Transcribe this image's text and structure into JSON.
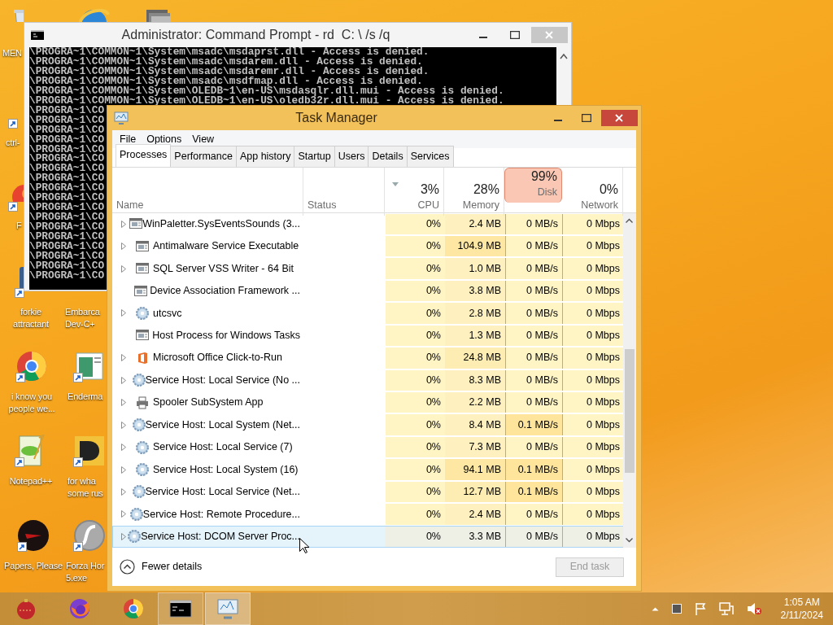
{
  "desktop": {
    "icons": [
      {
        "kind": "bin",
        "label_lines": [
          "MEN"
        ]
      },
      {
        "kind": "ie"
      },
      {
        "kind": "stack"
      },
      {
        "shortcut": true,
        "label_lines": [
          "ctrl-"
        ]
      },
      {
        "kind": "red-app",
        "shortcut": true,
        "label_lines": [
          "F"
        ]
      },
      {
        "kind": "app",
        "shortcut": true,
        "label_lines": [
          "forkie",
          "attractant"
        ]
      },
      {
        "label_lines": [
          "Embarca",
          "Dev-C+"
        ]
      },
      {
        "kind": "chrome",
        "shortcut": true,
        "label_lines": [
          "i know you",
          "people we..."
        ]
      },
      {
        "kind": "window-app",
        "shortcut": true,
        "label_lines": [
          "Enderma"
        ]
      },
      {
        "kind": "notepad",
        "shortcut": true,
        "label_lines": [
          "Notepad++"
        ]
      },
      {
        "kind": "yellow-app",
        "shortcut": true,
        "label_lines": [
          "for wha",
          "some rus"
        ]
      },
      {
        "kind": "dark-disc",
        "shortcut": true,
        "label_lines": [
          "Papers, Please"
        ]
      },
      {
        "kind": "flash",
        "shortcut": true,
        "label_lines": [
          "Forza Hor",
          "5.exe"
        ]
      }
    ]
  },
  "command_prompt": {
    "title": "Administrator: Command Prompt - rd  C: \\ /s /q",
    "lines": [
      "\\PROGRA~1\\COMMON~1\\System\\msadc\\msdaprst.dll - Access is denied.",
      "\\PROGRA~1\\COMMON~1\\System\\msadc\\msdarem.dll - Access is denied.",
      "\\PROGRA~1\\COMMON~1\\System\\msadc\\msdaremr.dll - Access is denied.",
      "\\PROGRA~1\\COMMON~1\\System\\msadc\\msdfmap.dll - Access is denied.",
      "\\PROGRA~1\\COMMON~1\\System\\OLEDB~1\\en-US\\msdasqlr.dll.mui - Access is denied.",
      "\\PROGRA~1\\COMMON~1\\System\\OLEDB~1\\en-US\\oledb32r.dll.mui - Access is denied.",
      "\\PROGRA~1\\CO",
      "\\PROGRA~1\\CO",
      "\\PROGRA~1\\CO",
      "\\PROGRA~1\\CO",
      "\\PROGRA~1\\CO",
      "\\PROGRA~1\\CO",
      "\\PROGRA~1\\CO",
      "\\PROGRA~1\\CO",
      "\\PROGRA~1\\CO",
      "\\PROGRA~1\\CO",
      "\\PROGRA~1\\CO",
      "\\PROGRA~1\\CO",
      "\\PROGRA~1\\CO",
      "\\PROGRA~1\\CO",
      "\\PROGRA~1\\CO",
      "\\PROGRA~1\\CO",
      "\\PROGRA~1\\CO",
      "\\PROGRA~1\\CO"
    ]
  },
  "task_manager": {
    "title": "Task Manager",
    "menu": [
      "File",
      "Options",
      "View"
    ],
    "tabs": [
      {
        "label": "Processes",
        "selected": true
      },
      {
        "label": "Performance",
        "selected": false
      },
      {
        "label": "App history",
        "selected": false
      },
      {
        "label": "Startup",
        "selected": false
      },
      {
        "label": "Users",
        "selected": false
      },
      {
        "label": "Details",
        "selected": false
      },
      {
        "label": "Services",
        "selected": false
      }
    ],
    "columns": [
      {
        "label": "Name",
        "alert": false
      },
      {
        "label": "Status",
        "alert": false
      },
      {
        "usage": "3%",
        "label": "CPU",
        "alert": false,
        "sorted": true
      },
      {
        "usage": "28%",
        "label": "Memory",
        "alert": false
      },
      {
        "usage": "99%",
        "label": "Disk",
        "alert": true
      },
      {
        "usage": "0%",
        "label": "Network",
        "alert": false
      }
    ],
    "rows": [
      {
        "name": "WinPaletter.SysEventsSounds (3...",
        "kind": "window",
        "expandable": true,
        "selected": false,
        "cpu": "0%",
        "memory": "2.4 MB",
        "disk": "0 MB/s",
        "network": "0 Mbps"
      },
      {
        "name": "Antimalware Service Executable",
        "kind": "window",
        "expandable": true,
        "selected": false,
        "cpu": "0%",
        "memory": "104.9 MB",
        "disk": "0 MB/s",
        "network": "0 Mbps"
      },
      {
        "name": "SQL Server VSS Writer - 64 Bit",
        "kind": "window",
        "expandable": true,
        "selected": false,
        "cpu": "0%",
        "memory": "1.0 MB",
        "disk": "0 MB/s",
        "network": "0 Mbps"
      },
      {
        "name": "Device Association Framework ...",
        "kind": "window",
        "expandable": false,
        "selected": false,
        "cpu": "0%",
        "memory": "3.8 MB",
        "disk": "0 MB/s",
        "network": "0 Mbps"
      },
      {
        "name": "utcsvc",
        "kind": "gear",
        "expandable": true,
        "selected": false,
        "cpu": "0%",
        "memory": "2.8 MB",
        "disk": "0 MB/s",
        "network": "0 Mbps"
      },
      {
        "name": "Host Process for Windows Tasks",
        "kind": "window",
        "expandable": false,
        "selected": false,
        "cpu": "0%",
        "memory": "1.3 MB",
        "disk": "0 MB/s",
        "network": "0 Mbps"
      },
      {
        "name": "Microsoft Office Click-to-Run",
        "kind": "office",
        "expandable": true,
        "selected": false,
        "cpu": "0%",
        "memory": "24.8 MB",
        "disk": "0 MB/s",
        "network": "0 Mbps"
      },
      {
        "name": "Service Host: Local Service (No ...",
        "kind": "gear",
        "expandable": true,
        "selected": false,
        "cpu": "0%",
        "memory": "8.3 MB",
        "disk": "0 MB/s",
        "network": "0 Mbps"
      },
      {
        "name": "Spooler SubSystem App",
        "kind": "printer",
        "expandable": true,
        "selected": false,
        "cpu": "0%",
        "memory": "2.2 MB",
        "disk": "0 MB/s",
        "network": "0 Mbps"
      },
      {
        "name": "Service Host: Local System (Net...",
        "kind": "gear",
        "expandable": true,
        "selected": false,
        "cpu": "0%",
        "memory": "8.4 MB",
        "disk": "0.1 MB/s",
        "network": "0 Mbps"
      },
      {
        "name": "Service Host: Local Service (7)",
        "kind": "gear",
        "expandable": true,
        "selected": false,
        "cpu": "0%",
        "memory": "7.3 MB",
        "disk": "0 MB/s",
        "network": "0 Mbps"
      },
      {
        "name": "Service Host: Local System (16)",
        "kind": "gear",
        "expandable": true,
        "selected": false,
        "cpu": "0%",
        "memory": "94.1 MB",
        "disk": "0.1 MB/s",
        "network": "0 Mbps"
      },
      {
        "name": "Service Host: Local Service (Net...",
        "kind": "gear",
        "expandable": true,
        "selected": false,
        "cpu": "0%",
        "memory": "12.7 MB",
        "disk": "0.1 MB/s",
        "network": "0 Mbps"
      },
      {
        "name": "Service Host: Remote Procedure...",
        "kind": "gear",
        "expandable": true,
        "selected": false,
        "cpu": "0%",
        "memory": "2.4 MB",
        "disk": "0 MB/s",
        "network": "0 Mbps"
      },
      {
        "name": "Service Host: DCOM Server Proc...",
        "kind": "gear",
        "expandable": true,
        "selected": true,
        "cpu": "0%",
        "memory": "3.3 MB",
        "disk": "0 MB/s",
        "network": "0 Mbps"
      }
    ],
    "footer": {
      "toggle": "Fewer details",
      "end_task": {
        "label": "End task",
        "disabled": true
      }
    }
  },
  "taskbar": {
    "apps": [
      {
        "kind": "ornament",
        "open": false,
        "selected": false
      },
      {
        "kind": "firefox",
        "open": false,
        "selected": false
      },
      {
        "kind": "chrome",
        "open": false,
        "selected": false
      },
      {
        "kind": "console",
        "open": true,
        "selected": false
      },
      {
        "kind": "monitor",
        "open": true,
        "selected": true
      }
    ],
    "volume_muted": true,
    "clock_time": "1:05 AM",
    "clock_date": "2/11/2024"
  }
}
